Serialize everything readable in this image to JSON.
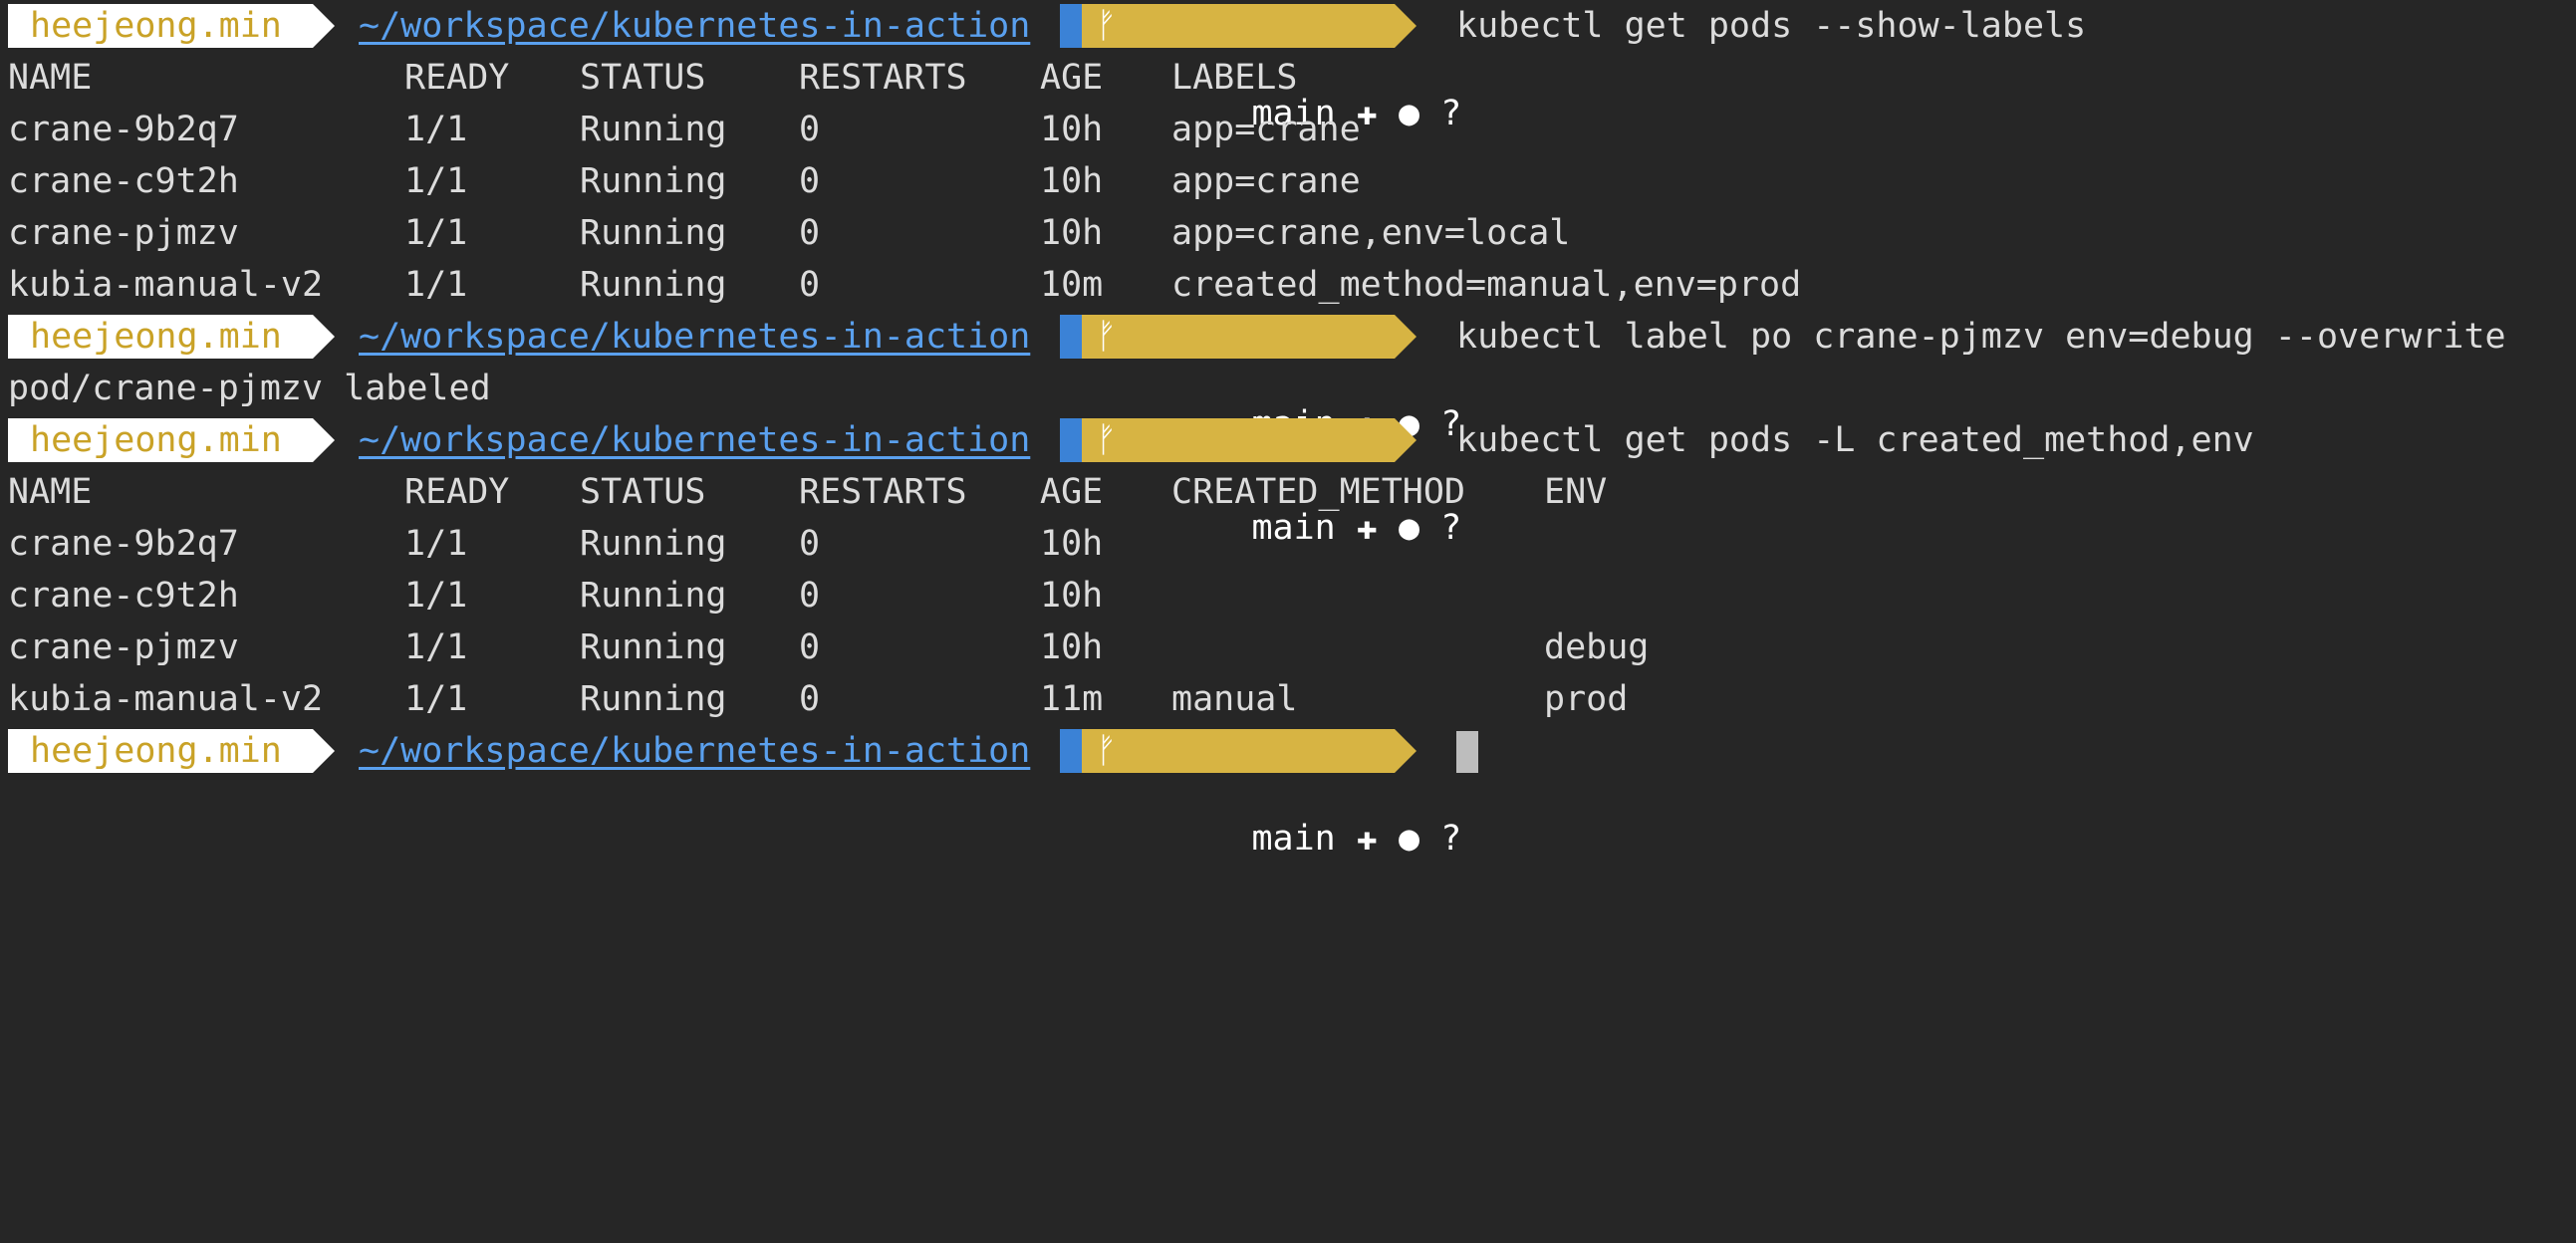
{
  "prompt": {
    "user": "heejeong.min",
    "path": "~/workspace/kubernetes-in-action",
    "branch_icon": "git-branch-icon",
    "git": "main ✚ ● ?"
  },
  "colors": {
    "background": "#262626",
    "text": "#dcdcdc",
    "user_fg": "#c9a227",
    "user_bg": "#ffffff",
    "path_fg": "#5aa0ee",
    "path_bg": "#3b82d6",
    "git_bg": "#d7b443"
  },
  "commands": [
    "kubectl get pods --show-labels",
    "kubectl label po crane-pjmzv env=debug --overwrite",
    "kubectl get pods -L created_method,env"
  ],
  "output1": {
    "headers": [
      "NAME",
      "READY",
      "STATUS",
      "RESTARTS",
      "AGE",
      "LABELS"
    ],
    "rows": [
      [
        "crane-9b2q7",
        "1/1",
        "Running",
        "0",
        "10h",
        "app=crane"
      ],
      [
        "crane-c9t2h",
        "1/1",
        "Running",
        "0",
        "10h",
        "app=crane"
      ],
      [
        "crane-pjmzv",
        "1/1",
        "Running",
        "0",
        "10h",
        "app=crane,env=local"
      ],
      [
        "kubia-manual-v2",
        "1/1",
        "Running",
        "0",
        "10m",
        "created_method=manual,env=prod"
      ]
    ]
  },
  "output2": "pod/crane-pjmzv labeled",
  "output3": {
    "headers": [
      "NAME",
      "READY",
      "STATUS",
      "RESTARTS",
      "AGE",
      "CREATED_METHOD",
      "ENV"
    ],
    "rows": [
      [
        "crane-9b2q7",
        "1/1",
        "Running",
        "0",
        "10h",
        "",
        ""
      ],
      [
        "crane-c9t2h",
        "1/1",
        "Running",
        "0",
        "10h",
        "",
        ""
      ],
      [
        "crane-pjmzv",
        "1/1",
        "Running",
        "0",
        "10h",
        "",
        "debug"
      ],
      [
        "kubia-manual-v2",
        "1/1",
        "Running",
        "0",
        "11m",
        "manual",
        "prod"
      ]
    ]
  }
}
